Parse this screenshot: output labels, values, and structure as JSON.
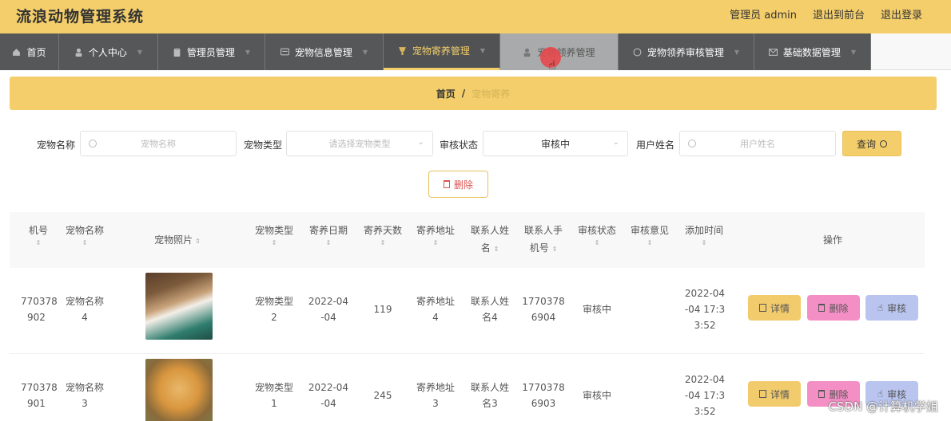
{
  "header": {
    "title": "流浪动物管理系统",
    "admin_label": "管理员 admin",
    "back_label": "退出到前台",
    "logout_label": "退出登录"
  },
  "nav": {
    "items": [
      {
        "label": "首页",
        "icon": "home-icon"
      },
      {
        "label": "个人中心",
        "icon": "user-icon"
      },
      {
        "label": "管理员管理",
        "icon": "clipboard-icon"
      },
      {
        "label": "宠物信息管理",
        "icon": "message-icon"
      },
      {
        "label": "宠物寄养管理",
        "icon": "cup-icon"
      },
      {
        "label": "宠物领养管理",
        "icon": "user-icon"
      },
      {
        "label": "宠物领养审核管理",
        "icon": "circle-icon"
      },
      {
        "label": "基础数据管理",
        "icon": "mail-icon"
      }
    ]
  },
  "breadcrumb": {
    "home": "首页",
    "separator": "/",
    "current": "宠物寄养"
  },
  "search": {
    "pet_name_label": "宠物名称",
    "pet_name_placeholder": "宠物名称",
    "pet_type_label": "宠物类型",
    "pet_type_placeholder": "请选择宠物类型",
    "audit_status_label": "审核状态",
    "audit_status_value": "审核中",
    "user_name_label": "用户姓名",
    "user_name_placeholder": "用户姓名",
    "query_label": "查询"
  },
  "toolbar": {
    "delete_label": "删除"
  },
  "table": {
    "headers": {
      "phone": "机号",
      "pet_name": "宠物名称",
      "pet_photo": "宠物照片",
      "pet_type": "宠物类型",
      "foster_date": "寄养日期",
      "foster_days": "寄养天数",
      "foster_address": "寄养地址",
      "contact_name_1": "联系人姓",
      "contact_name_2": "名",
      "contact_phone_1": "联系人手",
      "contact_phone_2": "机号",
      "audit_status": "审核状态",
      "audit_opinion": "审核意见",
      "add_time": "添加时间",
      "actions": "操作"
    },
    "rows": [
      {
        "phone_1": "770378",
        "phone_2": "902",
        "pet_name_1": "宠物名称",
        "pet_name_2": "4",
        "pet_type_1": "宠物类型",
        "pet_type_2": "2",
        "foster_date_1": "2022-04",
        "foster_date_2": "-04",
        "foster_days": "119",
        "address_1": "寄养地址",
        "address_2": "4",
        "contact_1": "联系人姓",
        "contact_2": "名4",
        "contact_phone_1": "1770378",
        "contact_phone_2": "6904",
        "audit_status": "审核中",
        "add_time_1": "2022-04",
        "add_time_2": "-04 17:3",
        "add_time_3": "3:52"
      },
      {
        "phone_1": "770378",
        "phone_2": "901",
        "pet_name_1": "宠物名称",
        "pet_name_2": "3",
        "pet_type_1": "宠物类型",
        "pet_type_2": "1",
        "foster_date_1": "2022-04",
        "foster_date_2": "-04",
        "foster_days": "245",
        "address_1": "寄养地址",
        "address_2": "3",
        "contact_1": "联系人姓",
        "contact_2": "名3",
        "contact_phone_1": "1770378",
        "contact_phone_2": "6903",
        "audit_status": "审核中",
        "add_time_1": "2022-04",
        "add_time_2": "-04 17:3",
        "add_time_3": "3:52"
      }
    ],
    "actions": {
      "detail": "详情",
      "delete": "删除",
      "audit": "审核"
    }
  },
  "watermark": "CSDN @计算机学姐"
}
